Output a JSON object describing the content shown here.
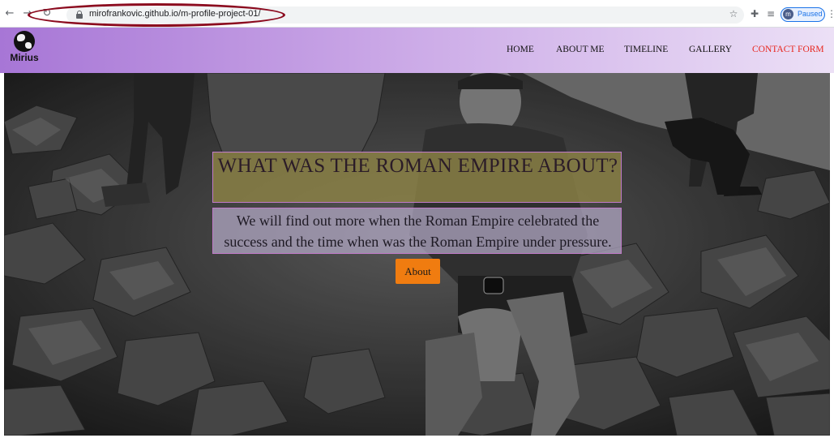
{
  "browser": {
    "url": "mirofrankovic.github.io/m-profile-project-01/",
    "profile_initial": "m",
    "profile_status": "Paused",
    "back_icon": "arrow-left-icon",
    "forward_icon": "arrow-right-icon",
    "reload_icon": "reload-icon",
    "lock_icon": "lock-icon",
    "annotation_color": "#8b0a1e"
  },
  "site": {
    "brand": "Mirius",
    "logo_icon": "globe-icon",
    "nav": [
      {
        "label": "HOME"
      },
      {
        "label": "ABOUT ME"
      },
      {
        "label": "TIMELINE"
      },
      {
        "label": "GALLERY"
      },
      {
        "label": "CONTACT FORM",
        "active": true
      }
    ],
    "active_color": "#e8271e",
    "header_gradient": [
      "#a776d6",
      "#ece0f6"
    ]
  },
  "hero": {
    "title": "WHAT WAS THE ROMAN EMPIRE ABOUT?",
    "subtitle": "We will find out more when the Roman Empire celebrated the success and the time when was the Roman Empire under pressure.",
    "button_label": "About",
    "button_color": "#f07c10"
  }
}
